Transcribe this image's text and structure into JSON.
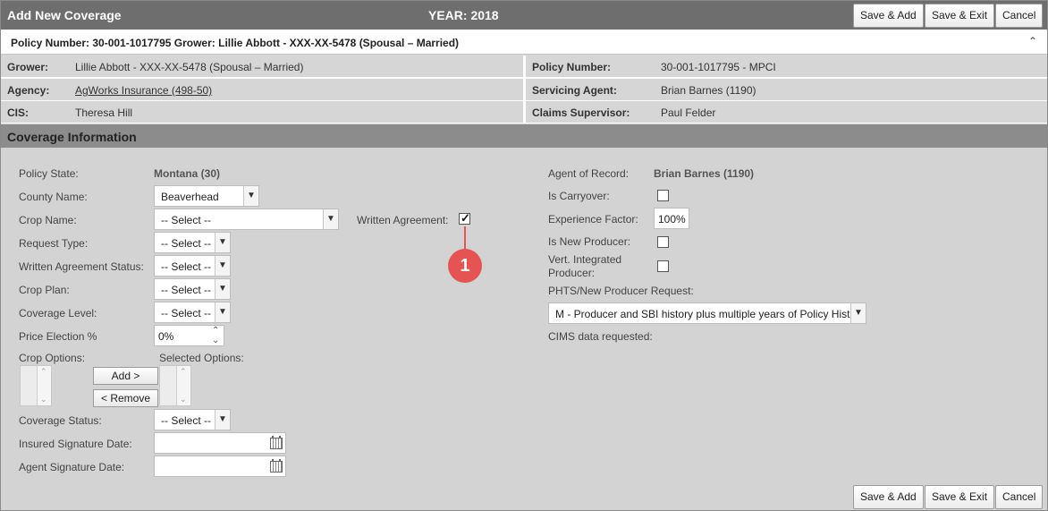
{
  "header": {
    "title": "Add New Coverage",
    "year": "YEAR: 2018",
    "save_add": "Save & Add",
    "save_exit": "Save & Exit",
    "cancel": "Cancel"
  },
  "policy_line": {
    "text": "Policy Number: 30-001-1017795 Grower: Lillie Abbott - XXX-XX-5478 (Spousal – Married)",
    "collapse_glyph": "⌃"
  },
  "info": {
    "grower_label": "Grower:",
    "grower_value": "Lillie Abbott - XXX-XX-5478 (Spousal – Married)",
    "agency_label": "Agency:",
    "agency_value": "AgWorks Insurance (498-50)",
    "cis_label": "CIS:",
    "cis_value": "Theresa Hill",
    "policy_label": "Policy Number:",
    "policy_value": "30-001-1017795 - MPCI",
    "servicing_label": "Servicing Agent:",
    "servicing_value": "Brian Barnes (1190)",
    "claims_label": "Claims Supervisor:",
    "claims_value": "Paul Felder"
  },
  "section": {
    "title": "Coverage Information"
  },
  "form": {
    "policy_state_label": "Policy State:",
    "policy_state_value": "Montana (30)",
    "county_label": "County Name:",
    "county_value": "Beaverhead",
    "crop_name_label": "Crop Name:",
    "crop_name_value": "-- Select --",
    "written_agreement_label": "Written Agreement:",
    "written_agreement_checked": true,
    "request_type_label": "Request Type:",
    "request_type_value": "-- Select --",
    "wa_status_label": "Written Agreement Status:",
    "wa_status_value": "-- Select --",
    "crop_plan_label": "Crop Plan:",
    "crop_plan_value": "-- Select --",
    "coverage_level_label": "Coverage Level:",
    "coverage_level_value": "-- Select --",
    "price_election_label": "Price Election %",
    "price_election_value": "0%",
    "crop_options_label": "Crop Options:",
    "selected_options_label": "Selected Options:",
    "add_label": "Add >",
    "remove_label": "< Remove",
    "coverage_status_label": "Coverage Status:",
    "coverage_status_value": "-- Select --",
    "insured_sig_label": "Insured Signature Date:",
    "insured_sig_value": "",
    "agent_sig_label": "Agent Signature Date:",
    "agent_sig_value": "",
    "agent_record_label": "Agent of Record:",
    "agent_record_value": "Brian Barnes (1190)",
    "carryover_label": "Is Carryover:",
    "experience_label": "Experience Factor:",
    "experience_value": "100%",
    "new_producer_label": "Is New Producer:",
    "vert_label_1": "Vert. Integrated",
    "vert_label_2": "Producer:",
    "phts_label": "PHTS/New Producer Request:",
    "phts_value": "M - Producer and SBI history plus multiple years of Policy History",
    "cims_label": "CIMS data requested:"
  },
  "annotation": {
    "number": "1",
    "color": "#e55353"
  },
  "footer": {
    "save_add": "Save & Add",
    "save_exit": "Save & Exit",
    "cancel": "Cancel"
  }
}
